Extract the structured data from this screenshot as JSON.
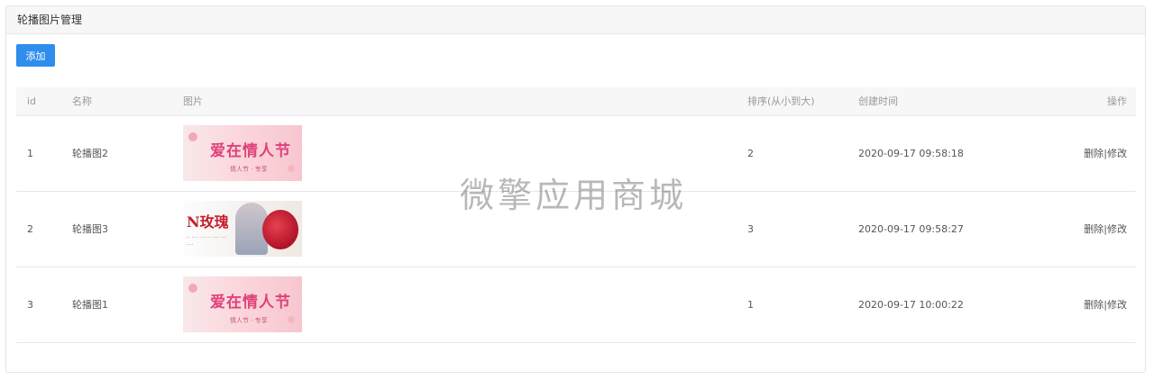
{
  "panel": {
    "title": "轮播图片管理"
  },
  "toolbar": {
    "add_label": "添加"
  },
  "table": {
    "headers": {
      "id": "id",
      "name": "名称",
      "image": "图片",
      "sort": "排序(从小到大)",
      "created": "创建时间",
      "actions": "操作"
    },
    "rows": [
      {
        "id": "1",
        "name": "轮播图2",
        "image": "banner-pink",
        "sort": "2",
        "created": "2020-09-17 09:58:18",
        "delete": "删除",
        "sep": "|",
        "edit": "修改"
      },
      {
        "id": "2",
        "name": "轮播图3",
        "image": "banner-white",
        "sort": "3",
        "created": "2020-09-17 09:58:27",
        "delete": "删除",
        "sep": "|",
        "edit": "修改"
      },
      {
        "id": "3",
        "name": "轮播图1",
        "image": "banner-pink",
        "sort": "1",
        "created": "2020-09-17 10:00:22",
        "delete": "删除",
        "sep": "|",
        "edit": "修改"
      }
    ]
  },
  "watermark": "微擎应用商城",
  "colors": {
    "primary": "#2e8ded",
    "header_bg": "#f7f7f7",
    "border": "#e8e8e8"
  }
}
